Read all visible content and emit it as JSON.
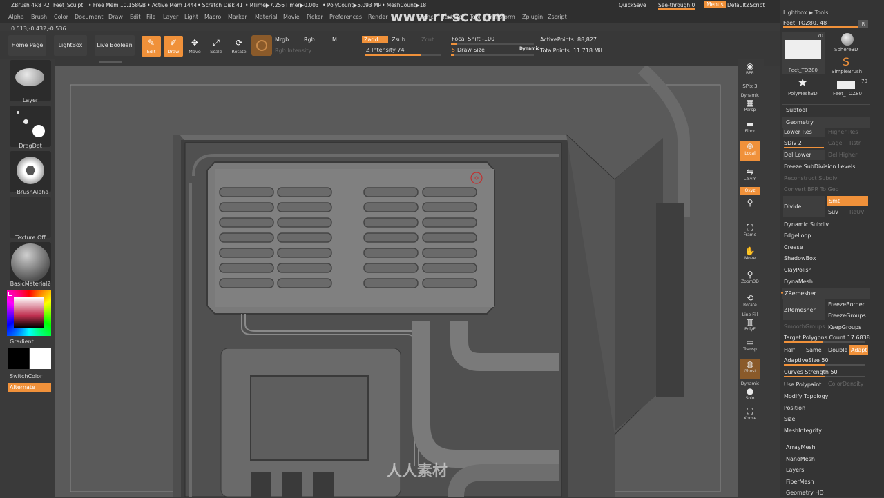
{
  "title_bar": {
    "app": "ZBrush 4R8 P2",
    "document": "Feet_Sculpt",
    "free_mem": "• Free Mem 10.158GB",
    "active_mem": "• Active Mem 1444",
    "scratch": "• Scratch Disk 41",
    "rtime": "• RTime▶7.256",
    "timer": "Timer▶0.003",
    "polycount": "• PolyCount▶5.093 MP",
    "meshcount": "• MeshCount▶18",
    "quicksave": "QuickSave",
    "see_through": "See-through  0",
    "menus": "Menus",
    "script": "DefaultZScript"
  },
  "menu": [
    "Alpha",
    "Brush",
    "Color",
    "Document",
    "Draw",
    "Edit",
    "File",
    "Layer",
    "Light",
    "Macro",
    "Marker",
    "Material",
    "Movie",
    "Picker",
    "Preferences",
    "Render",
    "Stencil",
    "Texture",
    "Tool",
    "Transform",
    "Zplugin",
    "Zscript"
  ],
  "watermark_url": "www.rr-sc.com",
  "coords": "0.513,-0.432,-0.536",
  "top_shelf": {
    "home": "Home Page",
    "lightbox": "LightBox",
    "live_boolean": "Live Boolean",
    "edit": "Edit",
    "draw": "Draw",
    "move": "Move",
    "scale": "Scale",
    "rotate": "Rotate",
    "mrgb": "Mrgb",
    "rgb": "Rgb",
    "m": "M",
    "rgb_intensity": "Rgb Intensity",
    "zadd": "Zadd",
    "zsub": "Zsub",
    "zcut": "Zcut",
    "z_intensity": "Z Intensity 74",
    "focal_shift": "Focal Shift -100",
    "draw_size": "Draw Size",
    "draw_size_value": "5",
    "dynamic": "Dynamic",
    "active_points": "ActivePoints: 88,827",
    "total_points": "TotalPoints: 11.718 Mil",
    "z_intensity_value": 0.74
  },
  "left_shelf": {
    "layer": "Layer",
    "dragdot": "DragDot",
    "brush_alpha": "~BrushAlpha",
    "texture_off": "Texture Off",
    "material": "BasicMaterial2",
    "gradient": "Gradient",
    "switch_color": "SwitchColor",
    "alternate": "Alternate"
  },
  "right_shelf": {
    "bpr": "BPR",
    "spix": "SPix 3",
    "dynamic": "Dynamic",
    "persp": "Persp",
    "floor": "Floor",
    "local": "Local",
    "lsym": "L.Sym",
    "xyz": "Qxyz",
    "frame": "Frame",
    "move": "Move",
    "zoom3d": "Zoom3D",
    "rotate": "Rotate",
    "line_fill": "Line Fill",
    "polyf": "PolyF",
    "transp": "Transp",
    "ghost": "Ghost",
    "solo": "Solo",
    "xpose": "Xpose"
  },
  "panel": {
    "lightbox_tools": "Lightbox ▶ Tools",
    "tool_name": "Feet_TOZ80. 48",
    "r_label": "R",
    "tools": [
      {
        "name": "Feet_TOZ80",
        "count": "70"
      },
      {
        "name": "Sphere3D",
        "count": ""
      },
      {
        "name": "SimpleBrush",
        "count": ""
      },
      {
        "name": "PolyMesh3D",
        "count": ""
      },
      {
        "name": "Feet_TOZ80",
        "count": "70"
      }
    ],
    "subtool": "Subtool",
    "geometry": "Geometry",
    "lower_res": "Lower Res",
    "higher_res": "Higher Res",
    "sdiv": "SDiv 2",
    "cage": "Cage",
    "rstr": "Rstr",
    "del_lower": "Del Lower",
    "del_higher": "Del Higher",
    "freeze_subdiv": "Freeze SubDivision Levels",
    "reconstruct": "Reconstruct Subdiv",
    "convert_bpr": "Convert BPR To Geo",
    "divide": "Divide",
    "smt": "Smt",
    "suv": "Suv",
    "reuv": "ReUV",
    "dynamic_subdiv": "Dynamic Subdiv",
    "edgeloop": "EdgeLoop",
    "crease": "Crease",
    "shadowbox": "ShadowBox",
    "claypolish": "ClayPolish",
    "dynamesh": "DynaMesh",
    "zremesher_header": "ZRemesher",
    "zremesher_btn": "ZRemesher",
    "freeze_border": "FreezeBorder",
    "freeze_groups": "FreezeGroups",
    "smooth_groups": "SmoothGroups",
    "keep_groups": "KeepGroups",
    "target_poly": "Target Polygons Count 17.6838",
    "half": "Half",
    "same": "Same",
    "double": "Double",
    "adapt": "Adapt",
    "adaptive_size": "AdaptiveSize 50",
    "curves_strength": "Curves Strength 50",
    "use_polypaint": "Use Polypaint",
    "color_density": "ColorDensity",
    "modify_topology": "Modify Topology",
    "position": "Position",
    "size": "Size",
    "mesh_integrity": "MeshIntegrity",
    "arraymesh": "ArrayMesh",
    "nanomesh": "NanoMesh",
    "layers": "Layers",
    "fibermesh": "FiberMesh",
    "geometry_hd": "Geometry HD"
  },
  "colors": {
    "accent": "#f0913a",
    "panel_bg": "#343434",
    "viewport": "#5e5e5e"
  }
}
